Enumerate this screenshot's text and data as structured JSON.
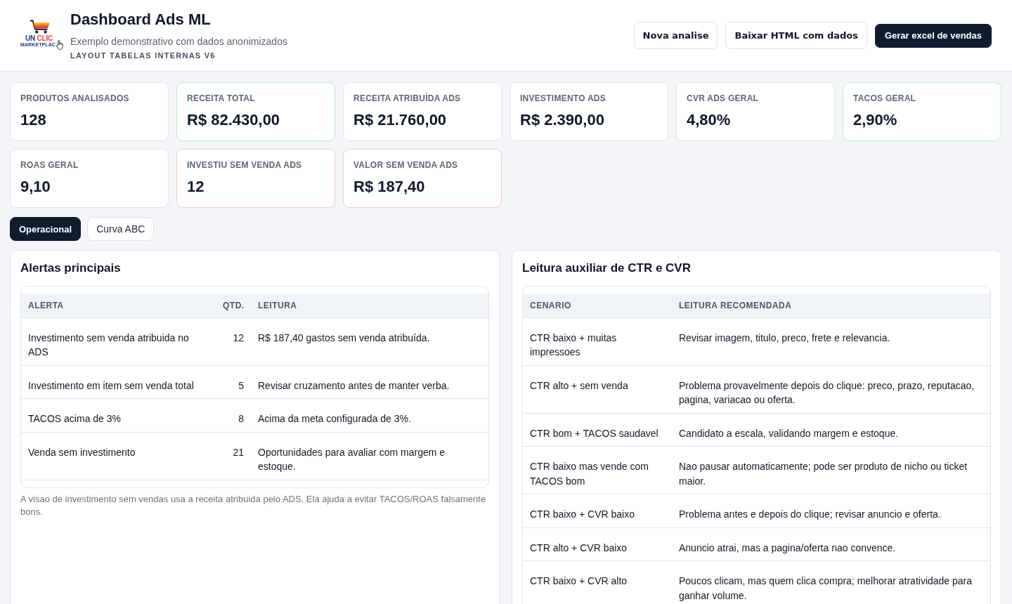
{
  "header": {
    "logo": {
      "wordmark": "UN CLIC",
      "tagline": "MARKETPLAC"
    },
    "title": "Dashboard Ads ML",
    "subtitle": "Exemplo demonstrativo com dados anonimizados",
    "version_label": "LAYOUT TABELAS INTERNAS V6",
    "buttons": [
      {
        "label": "Nova analise",
        "kind": "outline"
      },
      {
        "label": "Baixar HTML com dados",
        "kind": "outline"
      },
      {
        "label": "Gerar excel de vendas",
        "kind": "primary"
      }
    ]
  },
  "stats": [
    {
      "label": "PRODUTOS ANALISADOS",
      "value": "128",
      "color": "#dfe5ee"
    },
    {
      "label": "RECEITA TOTAL",
      "value": "R$ 82.430,00",
      "color": "#b7efcb"
    },
    {
      "label": "RECEITA ATRIBUÍDA ADS",
      "value": "R$ 21.760,00",
      "color": "#dfe5ee"
    },
    {
      "label": "INVESTIMENTO ADS",
      "value": "R$ 2.390,00",
      "color": "#dfe5ee"
    },
    {
      "label": "CVR ADS GERAL",
      "value": "4,80%",
      "color": "#dfe5ee"
    },
    {
      "label": "TACOS GERAL",
      "value": "2,90%",
      "color": "#b7efcb"
    },
    {
      "label": "ROAS GERAL",
      "value": "9,10",
      "color": "#dfe5ee"
    },
    {
      "label": "INVESTIU SEM VENDA ADS",
      "value": "12",
      "color": "#fcc9cc"
    },
    {
      "label": "VALOR SEM VENDA ADS",
      "value": "R$ 187,40",
      "color": "#fcc9cc"
    }
  ],
  "tabs": [
    {
      "label": "Operacional",
      "selected": true
    },
    {
      "label": "Curva ABC",
      "selected": false
    }
  ],
  "panels": [
    {
      "kind": "alerts",
      "title": "Alertas principais",
      "table": {
        "columns": [
          {
            "label": "ALERTA",
            "kind": "text"
          },
          {
            "label": "QTD.",
            "kind": "number"
          },
          {
            "label": "LEITURA",
            "kind": "text"
          }
        ],
        "rows": [
          [
            "Investimento sem venda atribuida no ADS",
            "12",
            "R$ 187,40 gastos sem venda atribuída."
          ],
          [
            "Investimento em item sem venda total",
            "5",
            "Revisar cruzamento antes de manter verba."
          ],
          [
            "TACOS acima de 3%",
            "8",
            "Acima da meta configurada de 3%."
          ],
          [
            "Venda sem investimento",
            "21",
            "Oportunidades para avaliar com margem e estoque."
          ]
        ]
      },
      "footnote": "A visao de investimento sem vendas usa a receita atribuida pelo ADS. Ela ajuda a evitar TACOS/ROAS falsamente bons."
    },
    {
      "kind": "guide",
      "title": "Leitura auxiliar de CTR e CVR",
      "table": {
        "columns": [
          {
            "label": "CENARIO",
            "kind": "text"
          },
          {
            "label": "LEITURA RECOMENDADA",
            "kind": "text"
          }
        ],
        "rows": [
          [
            "CTR baixo + muitas impressoes",
            "Revisar imagem, titulo, preco, frete e relevancia."
          ],
          [
            "CTR alto + sem venda",
            "Problema provavelmente depois do clique: preco, prazo, reputacao, pagina, variacao ou oferta."
          ],
          [
            "CTR bom + TACOS saudavel",
            "Candidato a escala, validando margem e estoque."
          ],
          [
            "CTR baixo mas vende com TACOS bom",
            "Nao pausar automaticamente; pode ser produto de nicho ou ticket maior."
          ],
          [
            "CTR baixo + CVR baixo",
            "Problema antes e depois do clique; revisar anuncio e oferta."
          ],
          [
            "CTR alto + CVR baixo",
            "Anuncio atrai, mas a pagina/oferta nao convence."
          ],
          [
            "CTR baixo + CVR alto",
            "Poucos clicam, mas quem clica compra; melhorar atratividade para ganhar volume."
          ]
        ]
      }
    }
  ]
}
